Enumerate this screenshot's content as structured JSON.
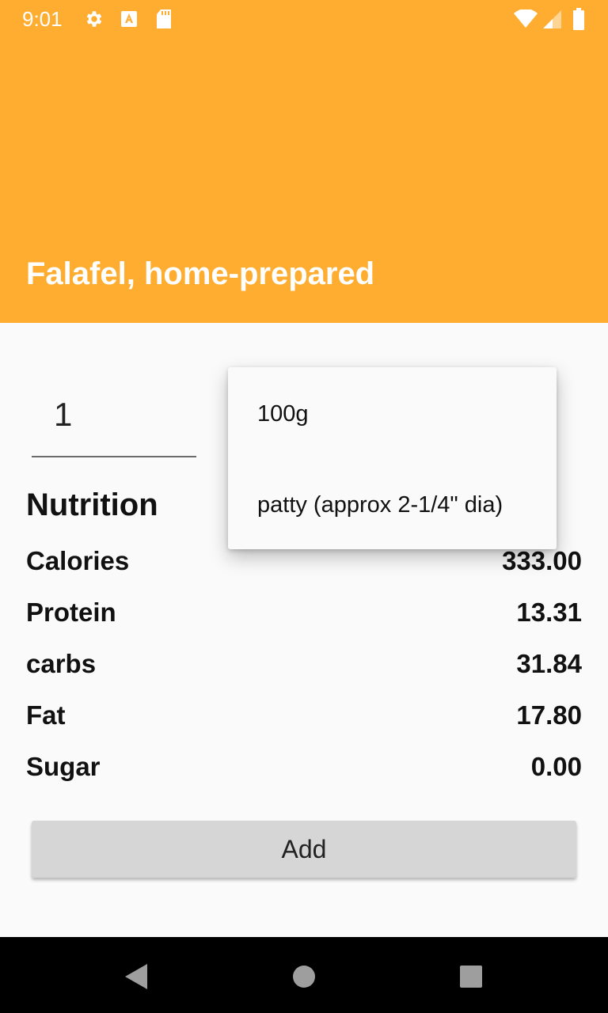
{
  "status_bar": {
    "time": "9:01",
    "left_icons": [
      "gear-icon",
      "a-badge-icon",
      "sd-card-icon"
    ],
    "right_icons": [
      "wifi-icon",
      "signal-icon",
      "battery-icon"
    ]
  },
  "app_bar": {
    "title": "Falafel, home-prepared",
    "color": "#ffad30"
  },
  "quantity": {
    "value": "1"
  },
  "nutrition": {
    "title": "Nutrition",
    "rows": [
      {
        "label": "Calories",
        "value": "333.00"
      },
      {
        "label": "Protein",
        "value": "13.31"
      },
      {
        "label": "carbs",
        "value": "31.84"
      },
      {
        "label": "Fat",
        "value": "17.80"
      },
      {
        "label": "Sugar",
        "value": "0.00"
      }
    ]
  },
  "unit_dropdown": {
    "options": [
      "100g",
      "patty (approx 2-1/4\" dia)"
    ]
  },
  "actions": {
    "add_label": "Add"
  },
  "nav_bar": {
    "buttons": [
      "back-icon",
      "home-icon",
      "recents-icon"
    ]
  }
}
